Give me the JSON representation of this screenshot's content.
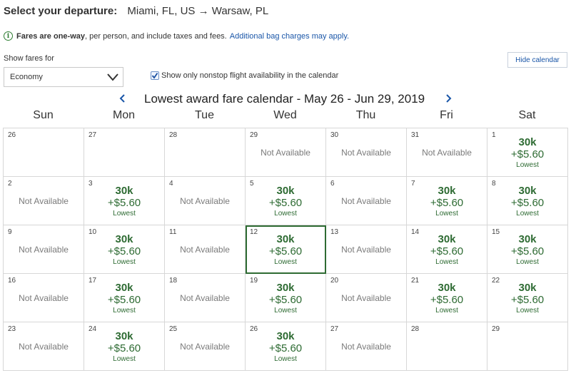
{
  "header": {
    "label": "Select your departure:",
    "route": "Miami, FL, US → Warsaw, PL"
  },
  "notice": {
    "bold": "Fares are one-way",
    "rest": ", per person, and include taxes and fees.",
    "link": "Additional bag charges may apply."
  },
  "filters": {
    "show_label": "Show fares for",
    "cabin": "Economy",
    "nonstop_label": "Show only nonstop flight availability in the calendar",
    "nonstop_checked": true,
    "hide_calendar": "Hide calendar"
  },
  "calendar": {
    "title": "Lowest award fare calendar - May 26 - Jun 29, 2019",
    "weekdays": [
      "Sun",
      "Mon",
      "Tue",
      "Wed",
      "Thu",
      "Fri",
      "Sat"
    ],
    "na_text": "Not Available",
    "lowest_text": "Lowest",
    "days": [
      {
        "day": "26",
        "status": "empty"
      },
      {
        "day": "27",
        "status": "empty"
      },
      {
        "day": "28",
        "status": "empty"
      },
      {
        "day": "29",
        "status": "na"
      },
      {
        "day": "30",
        "status": "na"
      },
      {
        "day": "31",
        "status": "na"
      },
      {
        "day": "1",
        "status": "fare",
        "miles": "30k",
        "tax": "+$5.60"
      },
      {
        "day": "2",
        "status": "na"
      },
      {
        "day": "3",
        "status": "fare",
        "miles": "30k",
        "tax": "+$5.60"
      },
      {
        "day": "4",
        "status": "na"
      },
      {
        "day": "5",
        "status": "fare",
        "miles": "30k",
        "tax": "+$5.60"
      },
      {
        "day": "6",
        "status": "na"
      },
      {
        "day": "7",
        "status": "fare",
        "miles": "30k",
        "tax": "+$5.60"
      },
      {
        "day": "8",
        "status": "fare",
        "miles": "30k",
        "tax": "+$5.60"
      },
      {
        "day": "9",
        "status": "na"
      },
      {
        "day": "10",
        "status": "fare",
        "miles": "30k",
        "tax": "+$5.60"
      },
      {
        "day": "11",
        "status": "na"
      },
      {
        "day": "12",
        "status": "fare",
        "miles": "30k",
        "tax": "+$5.60",
        "selected": true
      },
      {
        "day": "13",
        "status": "na"
      },
      {
        "day": "14",
        "status": "fare",
        "miles": "30k",
        "tax": "+$5.60"
      },
      {
        "day": "15",
        "status": "fare",
        "miles": "30k",
        "tax": "+$5.60"
      },
      {
        "day": "16",
        "status": "na"
      },
      {
        "day": "17",
        "status": "fare",
        "miles": "30k",
        "tax": "+$5.60"
      },
      {
        "day": "18",
        "status": "na"
      },
      {
        "day": "19",
        "status": "fare",
        "miles": "30k",
        "tax": "+$5.60"
      },
      {
        "day": "20",
        "status": "na"
      },
      {
        "day": "21",
        "status": "fare",
        "miles": "30k",
        "tax": "+$5.60"
      },
      {
        "day": "22",
        "status": "fare",
        "miles": "30k",
        "tax": "+$5.60"
      },
      {
        "day": "23",
        "status": "na"
      },
      {
        "day": "24",
        "status": "fare",
        "miles": "30k",
        "tax": "+$5.60"
      },
      {
        "day": "25",
        "status": "na"
      },
      {
        "day": "26",
        "status": "fare",
        "miles": "30k",
        "tax": "+$5.60"
      },
      {
        "day": "27",
        "status": "na"
      },
      {
        "day": "28",
        "status": "empty"
      },
      {
        "day": "29",
        "status": "empty"
      }
    ]
  },
  "colors": {
    "fare_green": "#2e6b33",
    "link_blue": "#1a56a8",
    "na_gray": "#7a7a7a"
  }
}
